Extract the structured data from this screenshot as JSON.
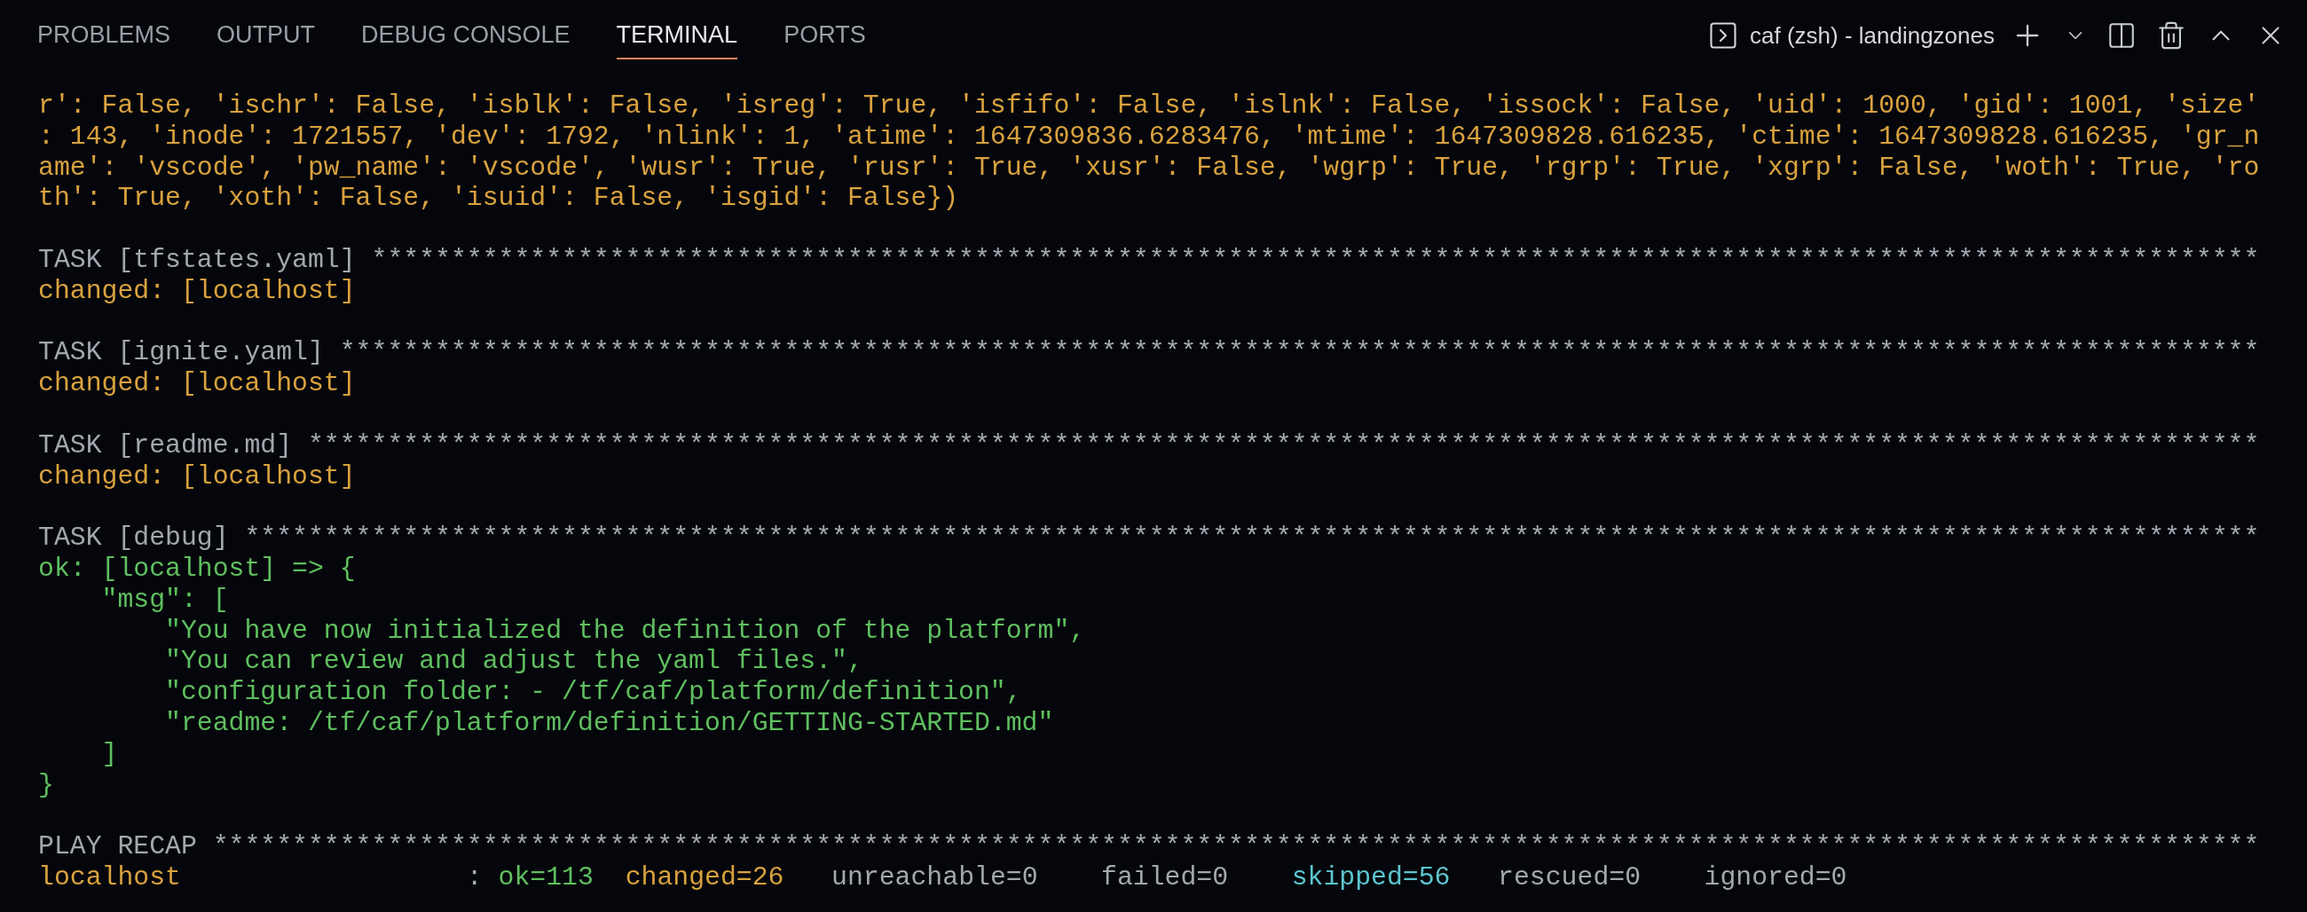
{
  "panel_tabs": [
    {
      "label": "PROBLEMS",
      "selected": false
    },
    {
      "label": "OUTPUT",
      "selected": false
    },
    {
      "label": "DEBUG CONSOLE",
      "selected": false
    },
    {
      "label": "TERMINAL",
      "selected": true
    },
    {
      "label": "PORTS",
      "selected": false
    }
  ],
  "terminal_title": "caf (zsh) - landingzones",
  "lines": [
    {
      "kind": "text",
      "segments": [
        {
          "text": "r': False, 'ischr': False, 'isblk': False, 'isreg': True, 'isfifo': False, 'islnk': False, 'issock': False, 'uid': 1000, 'gid': 1001, 'size'",
          "kind": "changed"
        }
      ]
    },
    {
      "kind": "text",
      "segments": [
        {
          "text": ": 143, 'inode': 1721557, 'dev': 1792, 'nlink': 1, 'atime': 1647309836.6283476, 'mtime': 1647309828.616235, 'ctime': 1647309828.616235, 'gr_n",
          "kind": "changed"
        }
      ]
    },
    {
      "kind": "text",
      "segments": [
        {
          "text": "ame': 'vscode', 'pw_name': 'vscode', 'wusr': True, 'rusr': True, 'xusr': False, 'wgrp': True, 'rgrp': True, 'xgrp': False, 'woth': True, 'ro",
          "kind": "changed"
        }
      ]
    },
    {
      "kind": "text",
      "segments": [
        {
          "text": "th': True, 'xoth': False, 'isuid': False, 'isgid': False})",
          "kind": "changed"
        }
      ]
    },
    {
      "kind": "blank"
    },
    {
      "kind": "text",
      "segments": [
        {
          "text": "TASK [tfstates.yaml] ***********************************************************************************************************************",
          "kind": "plain"
        }
      ]
    },
    {
      "kind": "text",
      "segments": [
        {
          "text": "changed: [localhost]",
          "kind": "changed"
        }
      ]
    },
    {
      "kind": "blank"
    },
    {
      "kind": "text",
      "segments": [
        {
          "text": "TASK [ignite.yaml] *************************************************************************************************************************",
          "kind": "plain"
        }
      ]
    },
    {
      "kind": "text",
      "segments": [
        {
          "text": "changed: [localhost]",
          "kind": "changed"
        }
      ]
    },
    {
      "kind": "blank"
    },
    {
      "kind": "text",
      "segments": [
        {
          "text": "TASK [readme.md] ***************************************************************************************************************************",
          "kind": "plain"
        }
      ]
    },
    {
      "kind": "text",
      "segments": [
        {
          "text": "changed: [localhost]",
          "kind": "changed"
        }
      ]
    },
    {
      "kind": "blank"
    },
    {
      "kind": "text",
      "segments": [
        {
          "text": "TASK [debug] *******************************************************************************************************************************",
          "kind": "plain"
        }
      ]
    },
    {
      "kind": "text",
      "segments": [
        {
          "text": "ok: [localhost] => {",
          "kind": "ok"
        }
      ]
    },
    {
      "kind": "text",
      "segments": [
        {
          "text": "    \"msg\": [",
          "kind": "ok"
        }
      ]
    },
    {
      "kind": "text",
      "segments": [
        {
          "text": "        \"You have now initialized the definition of the platform\",",
          "kind": "ok"
        }
      ]
    },
    {
      "kind": "text",
      "segments": [
        {
          "text": "        \"You can review and adjust the yaml files.\",",
          "kind": "ok"
        }
      ]
    },
    {
      "kind": "text",
      "segments": [
        {
          "text": "        \"configuration folder: - /tf/caf/platform/definition\",",
          "kind": "ok"
        }
      ]
    },
    {
      "kind": "text",
      "segments": [
        {
          "text": "        \"readme: /tf/caf/platform/definition/GETTING-STARTED.md\"",
          "kind": "ok"
        }
      ]
    },
    {
      "kind": "text",
      "segments": [
        {
          "text": "    ]",
          "kind": "ok"
        }
      ]
    },
    {
      "kind": "text",
      "segments": [
        {
          "text": "}",
          "kind": "ok"
        }
      ]
    },
    {
      "kind": "blank"
    },
    {
      "kind": "text",
      "segments": [
        {
          "text": "PLAY RECAP *********************************************************************************************************************************",
          "kind": "plain"
        }
      ]
    },
    {
      "kind": "text",
      "segments": [
        {
          "text": "localhost",
          "kind": "changed"
        },
        {
          "text": "                  : ",
          "kind": "plain"
        },
        {
          "text": "ok=113  ",
          "kind": "ok"
        },
        {
          "text": "changed=26",
          "kind": "changed"
        },
        {
          "text": "   unreachable=0    failed=0    ",
          "kind": "plain"
        },
        {
          "text": "skipped=56",
          "kind": "skipped"
        },
        {
          "text": "   rescued=0    ignored=0",
          "kind": "plain"
        }
      ]
    }
  ]
}
